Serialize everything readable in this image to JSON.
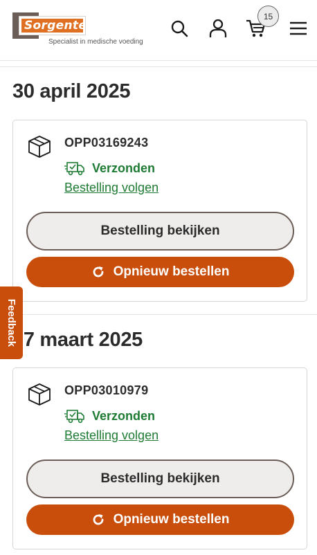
{
  "header": {
    "logo_text": "Sorgente",
    "logo_tagline": "Specialist in medische voeding",
    "cart_count": "15",
    "icons": [
      "search-icon",
      "user-icon",
      "cart-icon",
      "menu-icon"
    ]
  },
  "orders": [
    {
      "date": "30 april 2025",
      "order_number": "OPP03169243",
      "status": "Verzonden",
      "track_label": "Bestelling volgen",
      "view_label": "Bestelling bekijken",
      "reorder_label": "Opnieuw bestellen"
    },
    {
      "date": "27 maart 2025",
      "order_number": "OPP03010979",
      "status": "Verzonden",
      "track_label": "Bestelling volgen",
      "view_label": "Bestelling bekijken",
      "reorder_label": "Opnieuw bestellen"
    }
  ],
  "feedback_label": "Feedback",
  "colors": {
    "brand_orange": "#e07021",
    "button_orange": "#c94e0b",
    "status_green": "#1e7b34",
    "logo_brown": "#6b5d57"
  }
}
